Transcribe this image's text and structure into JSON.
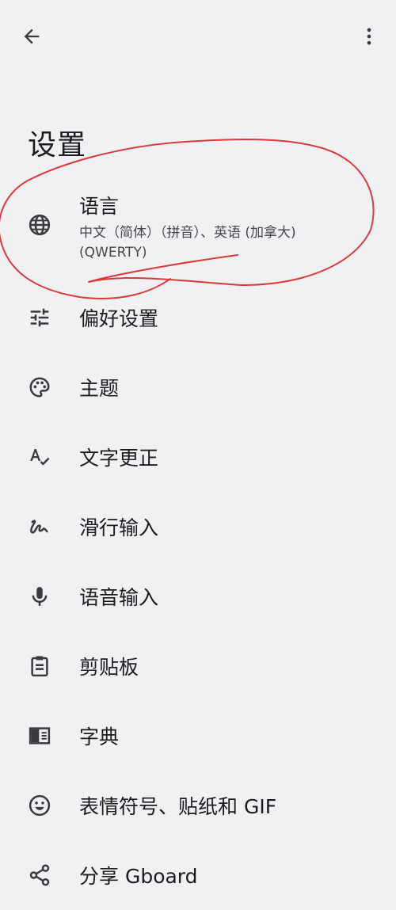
{
  "header": {
    "back_icon": "arrow-back-icon",
    "more_icon": "more-vert-icon",
    "title": "设置"
  },
  "settings": {
    "items": [
      {
        "label": "语言",
        "sublabel": "中文（简体）（拼音）、英语 (加拿大) (QWERTY)",
        "icon": "globe-icon"
      },
      {
        "label": "偏好设置",
        "icon": "tune-icon"
      },
      {
        "label": "主题",
        "icon": "palette-icon"
      },
      {
        "label": "文字更正",
        "icon": "spellcheck-icon"
      },
      {
        "label": "滑行输入",
        "icon": "gesture-icon"
      },
      {
        "label": "语音输入",
        "icon": "mic-icon"
      },
      {
        "label": "剪贴板",
        "icon": "clipboard-icon"
      },
      {
        "label": "字典",
        "icon": "dictionary-icon"
      },
      {
        "label": "表情符号、贴纸和 GIF",
        "icon": "emoji-icon"
      },
      {
        "label": "分享 Gboard",
        "icon": "share-icon"
      }
    ]
  },
  "colors": {
    "background": "#f1f0f3",
    "text": "#1c1b1f",
    "subtext": "#47464f",
    "annotation": "#d93a3a"
  }
}
